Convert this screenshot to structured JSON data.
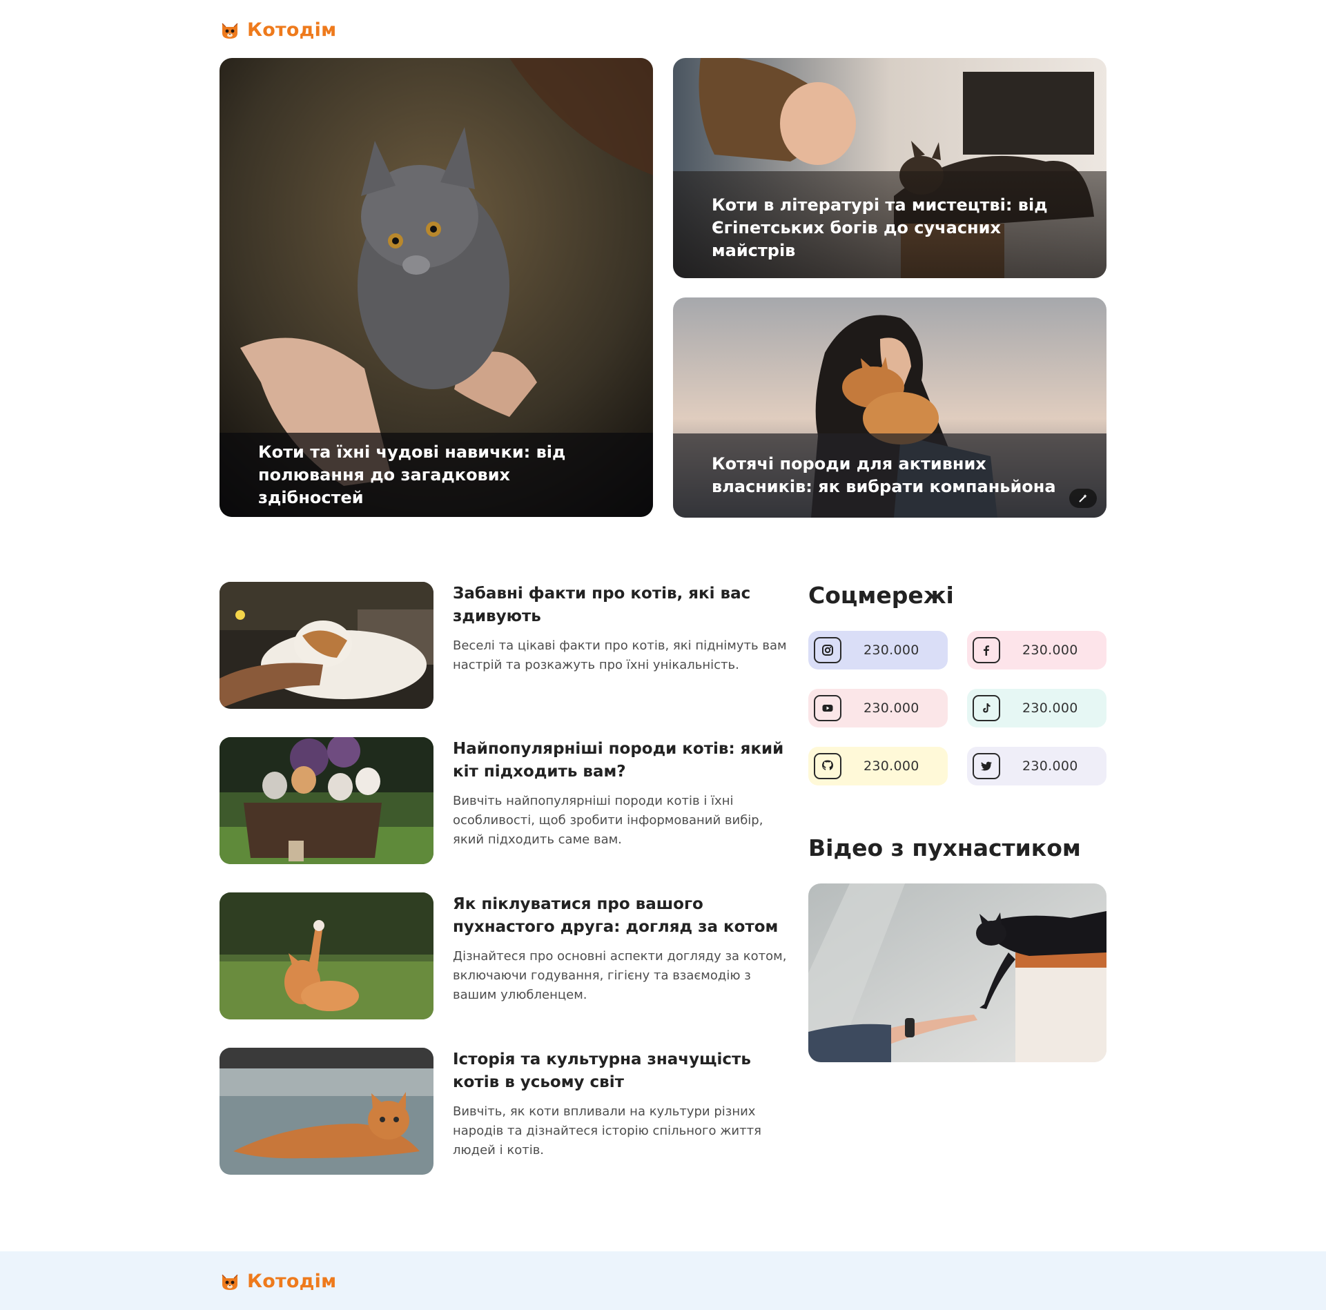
{
  "brand": {
    "name": "Котодім",
    "logo_icon": "cat-face-icon",
    "color": "#ee7a1c"
  },
  "hero": [
    {
      "title": "Коти та їхні чудові навички: від полювання до загадкових здібностей",
      "image": "woman-holding-grey-kitten"
    },
    {
      "title": "Коти в літературі та мистецтві: від Єгіпетських богів до сучасних майстрів",
      "image": "woman-laughing-with-cat"
    },
    {
      "title": "Котячі породи для активних власників: як вибрати компаньйона",
      "image": "woman-with-ginger-cat-on-shoulder"
    }
  ],
  "articles": [
    {
      "title": "Забавні факти про котів, які вас здивують",
      "desc": "Веселі та цікаві факти про котів, які піднімуть вам настрій та розкажуть про їхні унікальність."
    },
    {
      "title": "Найпопулярніші породи котів: який кіт підходить вам?",
      "desc": "Вивчіть найпопулярніші породи котів і їхні особливості, щоб зробити інформований вибір, який підходить саме вам."
    },
    {
      "title": "Як піклуватися про вашого пухнастого друга: догляд за котом",
      "desc": "Дізнайтеся про основні аспекти догляду за котом, включаючи годування, гігієну та взаємодію з вашим улюбленцем."
    },
    {
      "title": "Історія та культурна значущість котів в усьому світ",
      "desc": "Вивчіть, як коти впливали на культури різних народів та дізнайтеся історію спільного життя людей і котів."
    }
  ],
  "sidebar": {
    "social_title": "Соцмережі",
    "video_title": "Відео з пухнастиком",
    "social": [
      {
        "network": "instagram",
        "icon": "instagram-icon",
        "count": "230.000",
        "bg": "#dadef7"
      },
      {
        "network": "facebook",
        "icon": "facebook-icon",
        "count": "230.000",
        "bg": "#fde4ea"
      },
      {
        "network": "youtube",
        "icon": "youtube-icon",
        "count": "230.000",
        "bg": "#fbe6e8"
      },
      {
        "network": "tiktok",
        "icon": "tiktok-icon",
        "count": "230.000",
        "bg": "#e6f7f4"
      },
      {
        "network": "github",
        "icon": "github-icon",
        "count": "230.000",
        "bg": "#fff9d8"
      },
      {
        "network": "twitter",
        "icon": "twitter-icon",
        "count": "230.000",
        "bg": "#efeef8"
      }
    ]
  }
}
